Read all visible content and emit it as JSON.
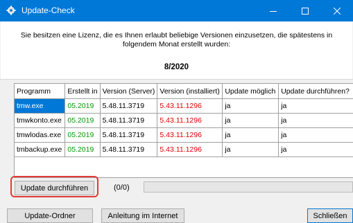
{
  "window": {
    "title": "Update-Check",
    "accent": "#0078d7"
  },
  "info": {
    "text": "Sie besitzen eine Lizenz, die es Ihnen erlaubt beliebige Versionen einzusetzen, die spätestens in folgendem Monat erstellt wurden:",
    "month": "8/2020"
  },
  "table": {
    "columns": [
      "Programm",
      "Erstellt in",
      "Version (Server)",
      "Version (installiert)",
      "Update möglich",
      "Update durchführen?"
    ],
    "rows": [
      {
        "programm": "tmw.exe",
        "erstellt": "05.2019",
        "server": "5.48.11.3719",
        "installiert": "5.43.11.1296",
        "moeglich": "ja",
        "durchfuehren": "ja"
      },
      {
        "programm": "tmwkonto.exe",
        "erstellt": "05.2019",
        "server": "5.48.11.3719",
        "installiert": "5.43.11.1296",
        "moeglich": "ja",
        "durchfuehren": "ja"
      },
      {
        "programm": "tmwlodas.exe",
        "erstellt": "05.2019",
        "server": "5.48.11.3719",
        "installiert": "5.43.11.1296",
        "moeglich": "ja",
        "durchfuehren": "ja"
      },
      {
        "programm": "tmbackup.exe",
        "erstellt": "05.2019",
        "server": "5.48.11.3719",
        "installiert": "5.43.11.1296",
        "moeglich": "ja",
        "durchfuehren": "ja"
      }
    ],
    "colors": {
      "erstellt": "#00a000",
      "installiert": "#e00000",
      "selected": "#0078d7"
    }
  },
  "actions": {
    "update_label": "Update durchführen",
    "progress_text": "(0/0)",
    "progress_value": 0
  },
  "footer": {
    "folder_label": "Update-Ordner",
    "guide_label": "Anleitung im Internet",
    "close_label": "Schließen"
  }
}
